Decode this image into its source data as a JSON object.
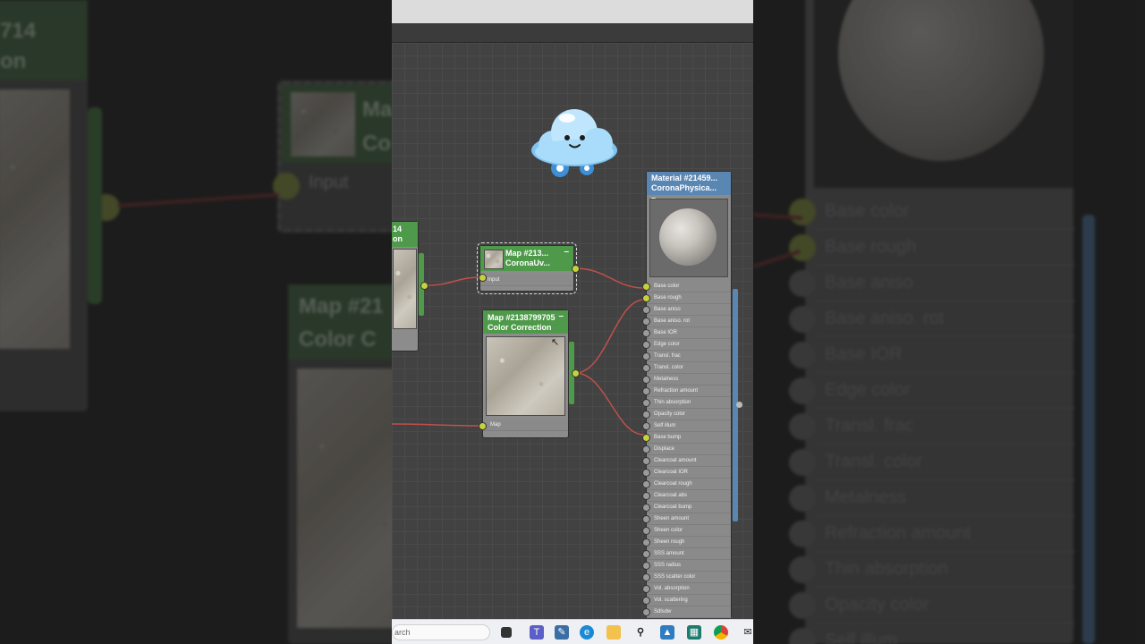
{
  "background_left": {
    "node_a_header": "714\non",
    "node_b_header": "Ma\nCo",
    "node_b_port": "Input",
    "node_c_header": "Map #21\nColor C"
  },
  "background_right": {
    "ports": [
      "Base color",
      "Base rough",
      "Base aniso",
      "Base aniso. rot",
      "Base IOR",
      "Edge color",
      "Transl. frac",
      "Transl. color",
      "Metalness",
      "Refraction amount",
      "Thin absorption",
      "Opacity color",
      "Self illum"
    ]
  },
  "nodes": {
    "partial_node": {
      "title_line1": "14",
      "title_line2": "on"
    },
    "uv_node": {
      "title_line1": "Map #213...",
      "title_line2": "CoronaUv...",
      "port": "Input",
      "min": "–"
    },
    "cc_node": {
      "title_line1": "Map #2138799705",
      "title_line2": "Color Correction",
      "port": "Map",
      "min": "–"
    },
    "material_node": {
      "title_line1": "Material #21459...",
      "title_line2": "CoronaPhysica...",
      "min": "–",
      "ports": [
        {
          "label": "Base color",
          "connected": true
        },
        {
          "label": "Base rough",
          "connected": true
        },
        {
          "label": "Base aniso",
          "connected": false
        },
        {
          "label": "Base aniso. rot",
          "connected": false
        },
        {
          "label": "Base IOR",
          "connected": false
        },
        {
          "label": "Edge color",
          "connected": false
        },
        {
          "label": "Transl. frac",
          "connected": false
        },
        {
          "label": "Transl. color",
          "connected": false
        },
        {
          "label": "Metalness",
          "connected": false
        },
        {
          "label": "Refraction amount",
          "connected": false
        },
        {
          "label": "Thin absorption",
          "connected": false
        },
        {
          "label": "Opacity color",
          "connected": false
        },
        {
          "label": "Self illum",
          "connected": false
        },
        {
          "label": "Base bump",
          "connected": true
        },
        {
          "label": "Displace",
          "connected": false
        },
        {
          "label": "Clearcoat amount",
          "connected": false
        },
        {
          "label": "Clearcoat IOR",
          "connected": false
        },
        {
          "label": "Clearcoat rough",
          "connected": false
        },
        {
          "label": "Clearcoat abs",
          "connected": false
        },
        {
          "label": "Clearcoat bump",
          "connected": false
        },
        {
          "label": "Sheen amount",
          "connected": false
        },
        {
          "label": "Sheen color",
          "connected": false
        },
        {
          "label": "Sheen rough",
          "connected": false
        },
        {
          "label": "SSS amount",
          "connected": false
        },
        {
          "label": "SSS radius",
          "connected": false
        },
        {
          "label": "SSS scatter color",
          "connected": false
        },
        {
          "label": "Vol. absorption",
          "connected": false
        },
        {
          "label": "Vol. scattering",
          "connected": false
        },
        {
          "label": "Sdlsdw",
          "connected": false
        }
      ]
    }
  },
  "taskbar": {
    "search_text": "arch",
    "icons": [
      "task-view-icon",
      "teams-icon",
      "pen-app-icon",
      "edge-browser-icon",
      "file-explorer-icon",
      "search-app-icon",
      "photos-icon",
      "calculator-icon",
      "chrome-icon",
      "mail-icon"
    ]
  },
  "colors": {
    "node_green": "#4e9a4a",
    "material_blue": "#5a86b3",
    "port_active": "#c4d23e",
    "wire_red": "#c0504d"
  }
}
